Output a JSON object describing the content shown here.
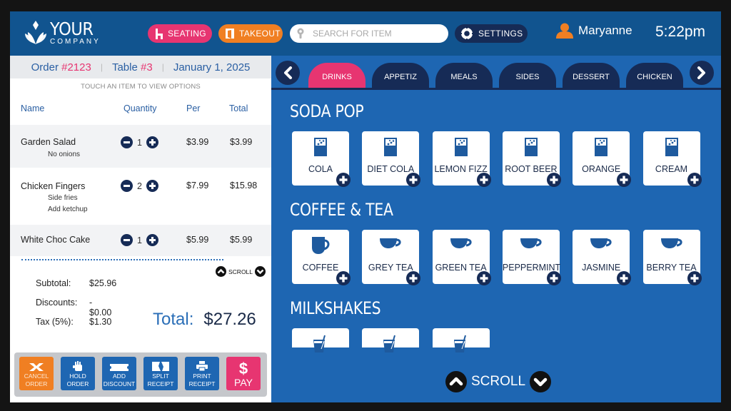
{
  "header": {
    "logo": {
      "line1": "YOUR",
      "line2": "COMPANY",
      "icon": "lotus-logo-icon"
    },
    "seating_label": "SEATING",
    "takeout_label": "TAKEOUT",
    "search_placeholder": "SEARCH FOR ITEM",
    "settings_label": "SETTINGS",
    "user_name": "Maryanne",
    "time": "5:22pm"
  },
  "order": {
    "order_label": "Order ",
    "order_number": "#2123",
    "table_label": "Table ",
    "table_number": "#3",
    "date": "January 1, 2025",
    "hint": "TOUCH AN ITEM TO VIEW OPTIONS",
    "columns": [
      "Name",
      "Quantity",
      "Per",
      "Total"
    ],
    "items": [
      {
        "name": "Garden Salad",
        "modifiers": [
          "No onions"
        ],
        "qty": "1",
        "per": "$3.99",
        "total": "$3.99"
      },
      {
        "name": "Chicken Fingers",
        "modifiers": [
          "Side fries",
          "Add ketchup"
        ],
        "qty": "2",
        "per": "$7.99",
        "total": "$15.98"
      },
      {
        "name": "White Choc Cake",
        "modifiers": [],
        "qty": "1",
        "per": "$5.99",
        "total": "$5.99"
      }
    ],
    "scroll_label": "SCROLL",
    "summary": {
      "subtotal_label": "Subtotal:",
      "subtotal": "$25.96",
      "discounts_label": "Discounts:",
      "discounts": "- $0.00",
      "tax_label": "Tax (5%):",
      "tax": "$1.30",
      "total_label": "Total:",
      "total": "$27.26"
    },
    "actions": [
      {
        "line1": "CANCEL",
        "line2": "ORDER"
      },
      {
        "line1": "HOLD",
        "line2": "ORDER"
      },
      {
        "line1": "ADD",
        "line2": "DISCOUNT"
      },
      {
        "line1": "SPLIT",
        "line2": "RECEIPT"
      },
      {
        "line1": "PRINT",
        "line2": "RECEIPT"
      },
      {
        "line1": "PAY",
        "line2": ""
      }
    ]
  },
  "menu": {
    "tabs": [
      "DRINKS",
      "APPETIZ",
      "MEALS",
      "SIDES",
      "DESSERT",
      "CHICKEN"
    ],
    "active_tab": "DRINKS",
    "categories": [
      {
        "title": "SODA POP",
        "icon": "soda-glass-icon",
        "items": [
          "COLA",
          "DIET COLA",
          "LEMON FIZZ",
          "ROOT BEER",
          "ORANGE",
          "CREAM"
        ]
      },
      {
        "title": "COFFEE & TEA",
        "icon": "tea-cup-icon",
        "items": [
          "COFFEE",
          "GREY TEA",
          "GREEN TEA",
          "PEPPERMINT",
          "JASMINE",
          "BERRY TEA"
        ]
      },
      {
        "title": "MILKSHAKES",
        "icon": "milkshake-icon",
        "items": [
          "",
          "",
          ""
        ]
      }
    ],
    "scroll_label": "SCROLL"
  },
  "colors": {
    "header_bg": "#11548f",
    "panel_blue": "#1e66b2",
    "navy": "#162b56",
    "pink": "#e73571",
    "orange": "#f07f22"
  }
}
